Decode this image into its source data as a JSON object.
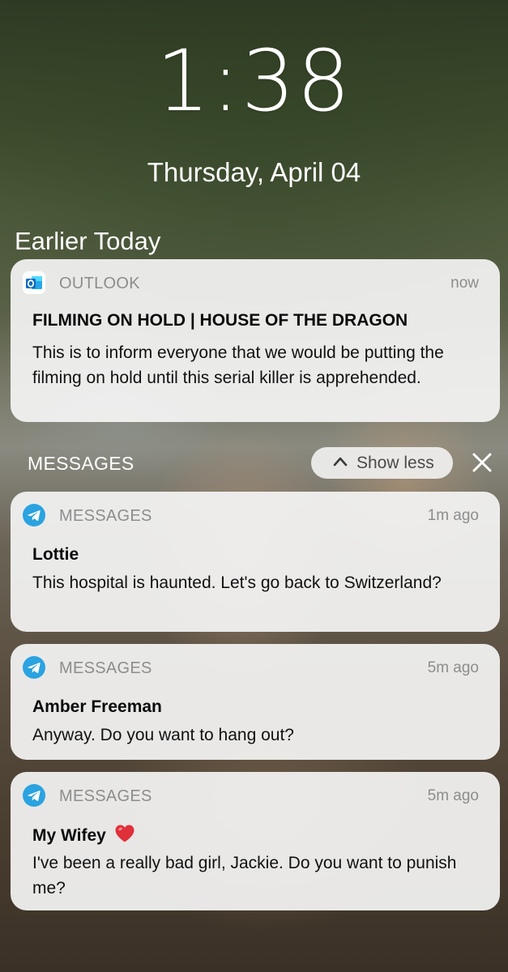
{
  "lock_screen": {
    "time": "1:38",
    "date": "Thursday, April 04",
    "section_label": "Earlier Today"
  },
  "notifications": {
    "outlook": {
      "app_name": "OUTLOOK",
      "app_icon": "outlook-icon",
      "timestamp": "now",
      "title": "FILMING ON HOLD | HOUSE OF THE DRAGON",
      "body": "This is to inform everyone that we would be putting the filming on hold until this serial killer is apprehended."
    },
    "messages_group": {
      "label": "MESSAGES",
      "show_less_label": "Show less",
      "collapse_icon": "chevron-up-icon",
      "close_icon": "close-icon",
      "items": [
        {
          "app_name": "MESSAGES",
          "app_icon": "telegram-icon",
          "timestamp": "1m ago",
          "sender": "Lottie",
          "body": "This hospital is haunted. Let's go back to Switzerland?"
        },
        {
          "app_name": "MESSAGES",
          "app_icon": "telegram-icon",
          "timestamp": "5m ago",
          "sender": "Amber Freeman",
          "body": "Anyway. Do you want to hang out?"
        },
        {
          "app_name": "MESSAGES",
          "app_icon": "telegram-icon",
          "timestamp": "5m ago",
          "sender": "My Wifey",
          "sender_emoji": "red-heart-icon",
          "body": "I've been a really bad girl, Jackie. Do you want to punish me?"
        }
      ]
    }
  },
  "colors": {
    "card_background": "#f4f4f4",
    "telegram_blue": "#2aa3e0",
    "outlook_blue": "#0f6cbd",
    "heart_red": "#e0303a"
  }
}
